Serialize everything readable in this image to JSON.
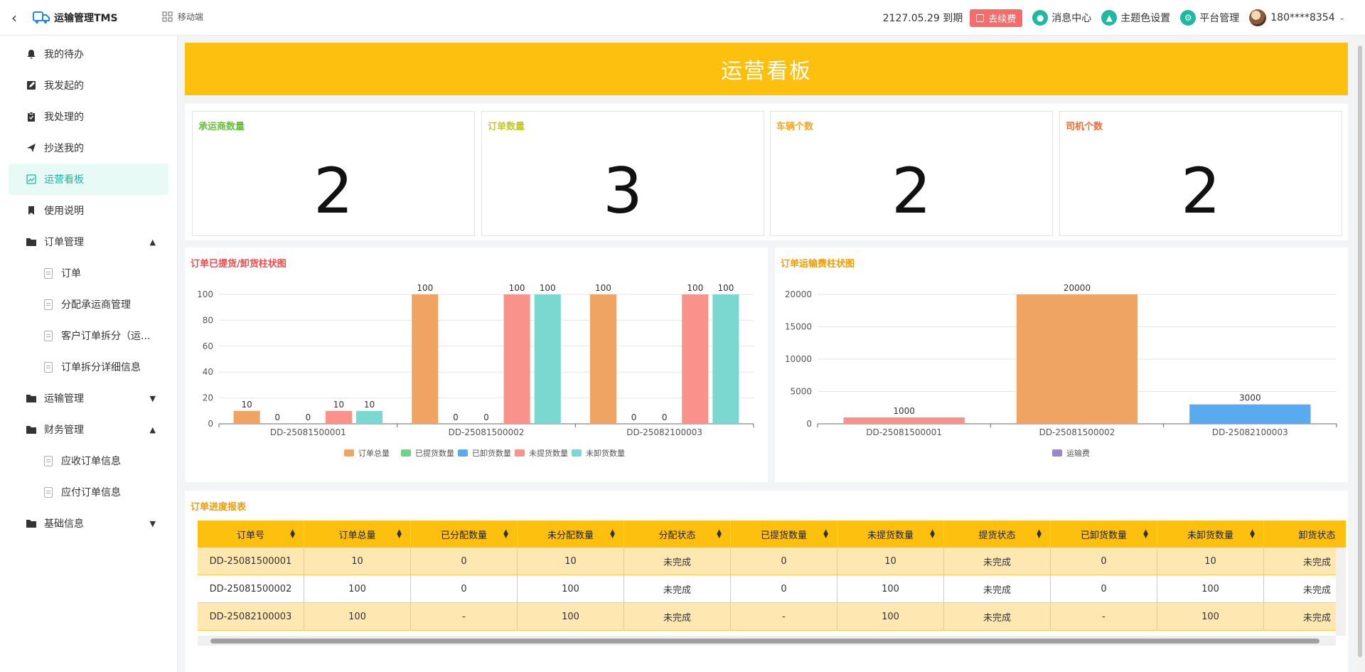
{
  "app": {
    "title": "运输管理TMS",
    "mobile_label": "移动端",
    "expire_text": "2127.05.29 到期",
    "renew_label": "去续费",
    "messages_label": "消息中心",
    "theme_label": "主题色设置",
    "platform_label": "平台管理",
    "user_name": "180****8354"
  },
  "sidebar": {
    "items": [
      {
        "label": "我的待办"
      },
      {
        "label": "我发起的"
      },
      {
        "label": "我处理的"
      },
      {
        "label": "抄送我的"
      },
      {
        "label": "运营看板"
      },
      {
        "label": "使用说明"
      },
      {
        "label": "订单管理"
      },
      {
        "label": "订单"
      },
      {
        "label": "分配承运商管理"
      },
      {
        "label": "客户订单拆分（运..."
      },
      {
        "label": "订单拆分详细信息"
      },
      {
        "label": "运输管理"
      },
      {
        "label": "财务管理"
      },
      {
        "label": "应收订单信息"
      },
      {
        "label": "应付订单信息"
      },
      {
        "label": "基础信息"
      }
    ]
  },
  "dashboard": {
    "banner_title": "运营看板",
    "stats": [
      {
        "label": "承运商数量",
        "value": "2",
        "color": "#67c23a"
      },
      {
        "label": "订单数量",
        "value": "3",
        "color": "#c5c928"
      },
      {
        "label": "车辆个数",
        "value": "2",
        "color": "#f5a623"
      },
      {
        "label": "司机个数",
        "value": "2",
        "color": "#f56c3a"
      }
    ],
    "table_title": "订单进度报表"
  },
  "chart_data": [
    {
      "type": "bar",
      "title": "订单已提货/卸货柱状图",
      "title_color": "#f5484a",
      "categories": [
        "DD-25081500001",
        "DD-25081500002",
        "DD-25082100003"
      ],
      "ylim": [
        0,
        100
      ],
      "yticks": [
        0,
        20,
        40,
        60,
        80,
        100
      ],
      "legend_position": "bottom",
      "grid": true,
      "series": [
        {
          "name": "订单总量",
          "values": [
            10,
            100,
            100
          ],
          "color": "#f0a464"
        },
        {
          "name": "已提货数量",
          "values": [
            0,
            0,
            0
          ],
          "color": "#6fd486"
        },
        {
          "name": "已卸货数量",
          "values": [
            0,
            0,
            0
          ],
          "color": "#5aaaf0"
        },
        {
          "name": "未提货数量",
          "values": [
            10,
            100,
            100
          ],
          "color": "#f8928a"
        },
        {
          "name": "未卸货数量",
          "values": [
            10,
            100,
            100
          ],
          "color": "#7ad8d0"
        }
      ]
    },
    {
      "type": "bar",
      "title": "订单运输费柱状图",
      "title_color": "#f59a00",
      "categories": [
        "DD-25081500001",
        "DD-25081500002",
        "DD-25082100003"
      ],
      "ylim": [
        0,
        20000
      ],
      "yticks": [
        0,
        5000,
        10000,
        15000,
        20000
      ],
      "legend_position": "bottom",
      "grid": true,
      "series": [
        {
          "name": "运输费",
          "values": [
            1000,
            20000,
            3000
          ],
          "color": "#9a86cc",
          "bar_colors": [
            "#f8928a",
            "#f0a464",
            "#5aaaf0"
          ]
        }
      ]
    }
  ],
  "table": {
    "columns": [
      "订单号",
      "订单总量",
      "已分配数量",
      "未分配数量",
      "分配状态",
      "已提货数量",
      "未提货数量",
      "提货状态",
      "已卸货数量",
      "未卸货数量",
      "卸货状态"
    ],
    "rows": [
      [
        "DD-25081500001",
        "10",
        "0",
        "10",
        "未完成",
        "0",
        "10",
        "未完成",
        "0",
        "10",
        "未完成"
      ],
      [
        "DD-25081500002",
        "100",
        "0",
        "100",
        "未完成",
        "0",
        "100",
        "未完成",
        "0",
        "100",
        "未完成"
      ],
      [
        "DD-25082100003",
        "100",
        "-",
        "100",
        "未完成",
        "-",
        "100",
        "未完成",
        "-",
        "100",
        "未完成"
      ]
    ]
  }
}
